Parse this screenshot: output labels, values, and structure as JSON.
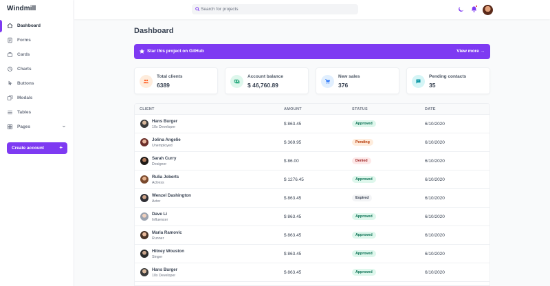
{
  "app": {
    "title": "Windmill"
  },
  "sidebar": {
    "items": [
      {
        "label": "Dashboard",
        "icon": "home-icon"
      },
      {
        "label": "Forms",
        "icon": "forms-icon"
      },
      {
        "label": "Cards",
        "icon": "cards-icon"
      },
      {
        "label": "Charts",
        "icon": "charts-icon"
      },
      {
        "label": "Buttons",
        "icon": "buttons-icon"
      },
      {
        "label": "Modals",
        "icon": "modals-icon"
      },
      {
        "label": "Tables",
        "icon": "tables-icon"
      },
      {
        "label": "Pages",
        "icon": "pages-icon"
      }
    ],
    "create_label": "Create account",
    "create_plus": "+"
  },
  "header": {
    "search_placeholder": "Search for projects"
  },
  "main": {
    "title": "Dashboard",
    "banner": {
      "text": "Star this project on GitHub",
      "link": "View more →"
    },
    "cards": [
      {
        "label": "Total clients",
        "value": "6389",
        "icon": "users-icon",
        "bg": "#feecdc",
        "fg": "#ff5a1f"
      },
      {
        "label": "Account balance",
        "value": "$ 46,760.89",
        "icon": "cash-icon",
        "bg": "#def7ec",
        "fg": "#0e9f6e"
      },
      {
        "label": "New sales",
        "value": "376",
        "icon": "cart-icon",
        "bg": "#e1effe",
        "fg": "#3f83f8"
      },
      {
        "label": "Pending contacts",
        "value": "35",
        "icon": "chat-icon",
        "bg": "#d5f5f6",
        "fg": "#0694a2"
      }
    ],
    "table": {
      "headers": [
        "CLIENT",
        "AMOUNT",
        "STATUS",
        "DATE"
      ],
      "rows": [
        {
          "name": "Hans Burger",
          "role": "10x Developer",
          "amount": "$ 863.45",
          "status": "Approved",
          "date": "6/10/2020"
        },
        {
          "name": "Jolina Angelie",
          "role": "Unemployed",
          "amount": "$ 369.95",
          "status": "Pending",
          "date": "6/10/2020"
        },
        {
          "name": "Sarah Curry",
          "role": "Designer",
          "amount": "$ 86.00",
          "status": "Denied",
          "date": "6/10/2020"
        },
        {
          "name": "Rulia Joberts",
          "role": "Actress",
          "amount": "$ 1276.45",
          "status": "Approved",
          "date": "6/10/2020"
        },
        {
          "name": "Wenzel Dashington",
          "role": "Actor",
          "amount": "$ 863.45",
          "status": "Expired",
          "date": "6/10/2020"
        },
        {
          "name": "Dave Li",
          "role": "Influencer",
          "amount": "$ 863.45",
          "status": "Approved",
          "date": "6/10/2020"
        },
        {
          "name": "Maria Ramovic",
          "role": "Runner",
          "amount": "$ 863.45",
          "status": "Approved",
          "date": "6/10/2020"
        },
        {
          "name": "Hitney Wouston",
          "role": "Singer",
          "amount": "$ 863.45",
          "status": "Approved",
          "date": "6/10/2020"
        },
        {
          "name": "Hans Burger",
          "role": "10x Developer",
          "amount": "$ 863.45",
          "status": "Approved",
          "date": "6/10/2020"
        }
      ]
    }
  },
  "colors": {
    "accent": "#7e3af2"
  }
}
